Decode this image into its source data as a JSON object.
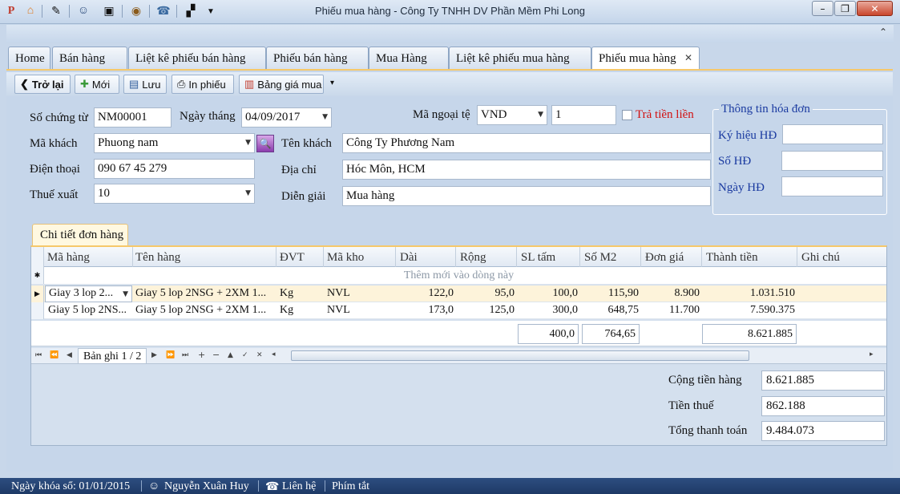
{
  "window": {
    "title": "Phiếu mua hàng - Công Ty TNHH DV Phần Mềm Phi Long",
    "minimize_icon": "minimize-icon",
    "restore_icon": "restore-icon",
    "close_icon": "close-icon"
  },
  "quick_access": [
    "app-logo-icon",
    "home-icon",
    "tools-icon",
    "users-icon",
    "clapper-icon",
    "eye-icon",
    "phone-icon",
    "layout-icon",
    "dropdown-icon"
  ],
  "tabs": [
    {
      "label": "Home"
    },
    {
      "label": "Bán hàng"
    },
    {
      "label": "Liệt kê phiếu bán hàng"
    },
    {
      "label": "Phiếu bán hàng"
    },
    {
      "label": "Mua Hàng"
    },
    {
      "label": "Liệt kê phiếu mua hàng"
    },
    {
      "label": "Phiếu mua hàng",
      "active": true
    }
  ],
  "toolbar": {
    "back": "Trở lại",
    "new": "Mới",
    "save": "Lưu",
    "print": "In phiếu",
    "price_list": "Bảng giá mua"
  },
  "form": {
    "so_chung_tu_label": "Số chứng từ",
    "so_chung_tu": "NM00001",
    "ngay_thang_label": "Ngày tháng",
    "ngay_thang": "04/09/2017",
    "ma_ngoai_te_label": "Mã ngoại tệ",
    "ma_ngoai_te": "VND",
    "ty_gia": "1",
    "tra_tien_lien": "Trả tiền liền",
    "ma_khach_label": "Mã khách",
    "ma_khach": "Phuong nam",
    "ten_khach_label": "Tên khách",
    "ten_khach": "Công Ty Phương Nam",
    "dien_thoai_label": "Điện thoại",
    "dien_thoai": "090 67 45 279",
    "dia_chi_label": "Địa chỉ",
    "dia_chi": "Hóc Môn, HCM",
    "thue_xuat_label": "Thuế xuất",
    "thue_xuat": "10",
    "dien_giai_label": "Diễn giải",
    "dien_giai": "Mua hàng"
  },
  "invoice": {
    "title": "Thông tin hóa đơn",
    "ky_hieu_label": "Ký hiệu HĐ",
    "so_hd_label": "Số HĐ",
    "ngay_hd_label": "Ngày HĐ",
    "ky_hieu": "",
    "so_hd": "",
    "ngay_hd": ""
  },
  "detail": {
    "tab_label": "Chi tiết đơn hàng",
    "columns": [
      "Mã hàng",
      "Tên hàng",
      "ĐVT",
      "Mã kho",
      "Dài",
      "Rộng",
      "SL tấm",
      "Số M2",
      "Đơn giá",
      "Thành tiền",
      "Ghi chú"
    ],
    "new_row_hint": "Thêm mới vào dòng này",
    "rows": [
      [
        "Giay 3 lop 2...",
        "Giay 5 lop 2NSG + 2XM 1...",
        "Kg",
        "NVL",
        "122,0",
        "95,0",
        "100,0",
        "115,90",
        "8.900",
        "1.031.510",
        ""
      ],
      [
        "Giay 5 lop 2NS...",
        "Giay 5 lop 2NSG + 2XM 1...",
        "Kg",
        "NVL",
        "173,0",
        "125,0",
        "300,0",
        "648,75",
        "11.700",
        "7.590.375",
        ""
      ]
    ],
    "sum_sl_tam": "400,0",
    "sum_m2": "764,65",
    "sum_thanh_tien": "8.621.885",
    "record_text": "Bản ghi 1 / 2"
  },
  "totals": {
    "cong_tien_hang_label": "Cộng tiền hàng",
    "cong_tien_hang": "8.621.885",
    "tien_thue_label": "Tiền thuế",
    "tien_thue": "862.188",
    "tong_thanh_toan_label": "Tổng thanh toán",
    "tong_thanh_toan": "9.484.073"
  },
  "status": {
    "ngay_khoa_so": "Ngày khóa sổ: 01/01/2015",
    "user": "Nguyễn Xuân Huy",
    "lien_he": "Liên hệ",
    "phim_tat": "Phím tắt"
  },
  "colors": {
    "accent": "#f6c86a",
    "status_bar": "#1e3a66",
    "highlight_red": "#d21010",
    "invoice_blue": "#1a3aa0"
  }
}
